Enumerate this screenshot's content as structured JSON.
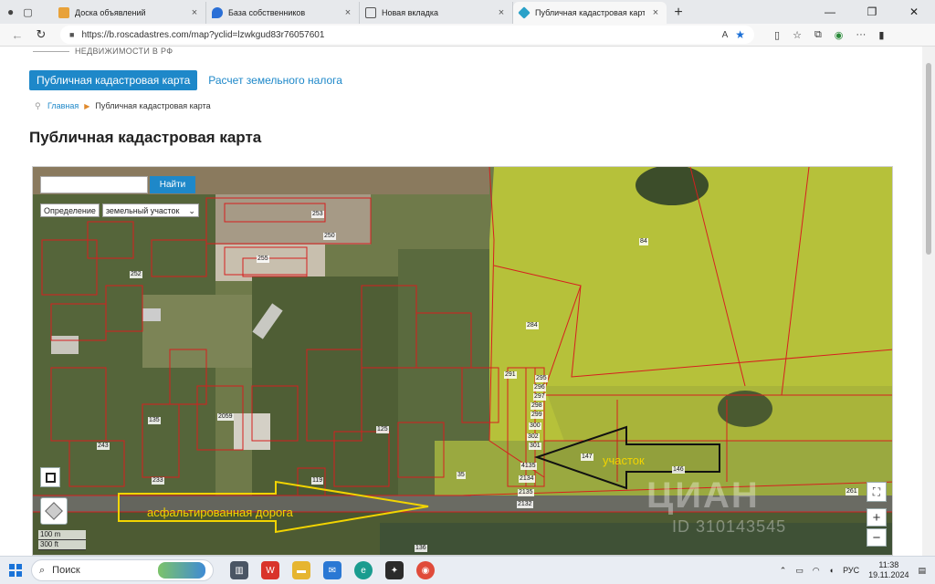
{
  "browser": {
    "tabs": [
      {
        "title": "Доска объявлений",
        "active": false
      },
      {
        "title": "База собственников",
        "active": false
      },
      {
        "title": "Новая вкладка",
        "active": false
      },
      {
        "title": "Публичная кадастровая карта",
        "active": true
      }
    ],
    "url": "https://b.roscadastres.com/map?yclid=lzwkgud83r76057601"
  },
  "page": {
    "header_stub": "НЕДВИЖИМОСТИ В РФ",
    "nav": {
      "primary": "Публичная кадастровая карта",
      "secondary": "Расчет земельного налога"
    },
    "breadcrumb": {
      "home": "Главная",
      "current": "Публичная кадастровая карта"
    },
    "title": "Публичная кадастровая карта"
  },
  "map": {
    "search_placeholder": "",
    "search_button": "Найти",
    "definition_label": "Определение",
    "definition_value": "земельный участок",
    "scale": [
      "100 m",
      "300 ft"
    ],
    "zoom_in": "+",
    "zoom_out": "−",
    "annotation_road": "асфальтированная дорога",
    "annotation_plot": "участок",
    "watermark": "ЦИАН",
    "watermark_sub": "ID 310143545",
    "parcel_labels": [
      {
        "t": "253"
      },
      {
        "t": "250"
      },
      {
        "t": "255"
      },
      {
        "t": "252"
      },
      {
        "t": "84"
      },
      {
        "t": "284"
      },
      {
        "t": "295"
      },
      {
        "t": "296"
      },
      {
        "t": "297"
      },
      {
        "t": "298"
      },
      {
        "t": "299"
      },
      {
        "t": "300"
      },
      {
        "t": "301"
      },
      {
        "t": "302"
      },
      {
        "t": "4135"
      },
      {
        "t": "2134"
      },
      {
        "t": "2135"
      },
      {
        "t": "2132"
      },
      {
        "t": "147"
      },
      {
        "t": "146"
      },
      {
        "t": "261"
      },
      {
        "t": "2059"
      },
      {
        "t": "125"
      },
      {
        "t": "119"
      },
      {
        "t": "233"
      },
      {
        "t": "243"
      },
      {
        "t": "35"
      },
      {
        "t": "135"
      },
      {
        "t": "136"
      },
      {
        "t": "291"
      }
    ]
  },
  "taskbar": {
    "search": "Поиск",
    "lang": "РУС",
    "time": "11:38",
    "date": "19.11.2024"
  },
  "colors": {
    "accent": "#1e88c9",
    "field": "#b9c53a",
    "parcel_line": "#d61f1f",
    "annotation": "#f2d400"
  }
}
